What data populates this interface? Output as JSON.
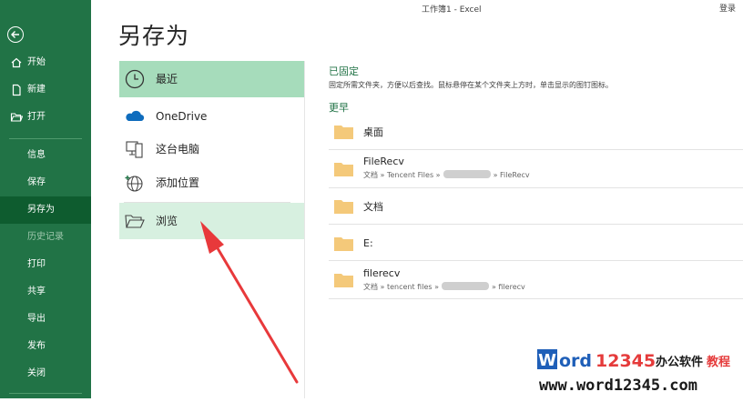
{
  "topbar": {
    "doc_title": "工作簿1  -  Excel",
    "login": "登录"
  },
  "page_title": "另存为",
  "nav": {
    "items": [
      {
        "label": "开始"
      },
      {
        "label": "新建"
      },
      {
        "label": "打开"
      },
      {
        "label": "信息"
      },
      {
        "label": "保存"
      },
      {
        "label": "另存为"
      },
      {
        "label": "历史记录"
      },
      {
        "label": "打印"
      },
      {
        "label": "共享"
      },
      {
        "label": "导出"
      },
      {
        "label": "发布"
      },
      {
        "label": "关闭"
      }
    ]
  },
  "locations": {
    "recent": "最近",
    "onedrive": "OneDrive",
    "this_pc": "这台电脑",
    "add_place": "添加位置",
    "browse": "浏览"
  },
  "pinned": {
    "title": "已固定",
    "desc": "固定所需文件夹，方便以后查找。鼠标悬停在某个文件夹上方时，单击显示的图钉图标。"
  },
  "older": {
    "title": "更早",
    "folders": [
      {
        "name": "桌面"
      },
      {
        "name": "FileRecv",
        "path_start": "文档 » Tencent Files »",
        "path_end": "» FileRecv"
      },
      {
        "name": "文档"
      },
      {
        "name": "E:"
      },
      {
        "name": "filerecv",
        "path_start": "文档 » tencent files »",
        "path_end": "» filerecv"
      }
    ]
  },
  "watermark": {
    "brand": "Word12345",
    "tagline": "办公软件教程",
    "url": "www.word12345.com"
  },
  "colors": {
    "nav_bg": "#217346",
    "nav_active": "#0e5c2f",
    "accent_text": "#217346",
    "selected": "#a6dcbb",
    "hover": "#d7f0e0",
    "folder": "#f4c97a",
    "arrow": "#e8393b"
  }
}
